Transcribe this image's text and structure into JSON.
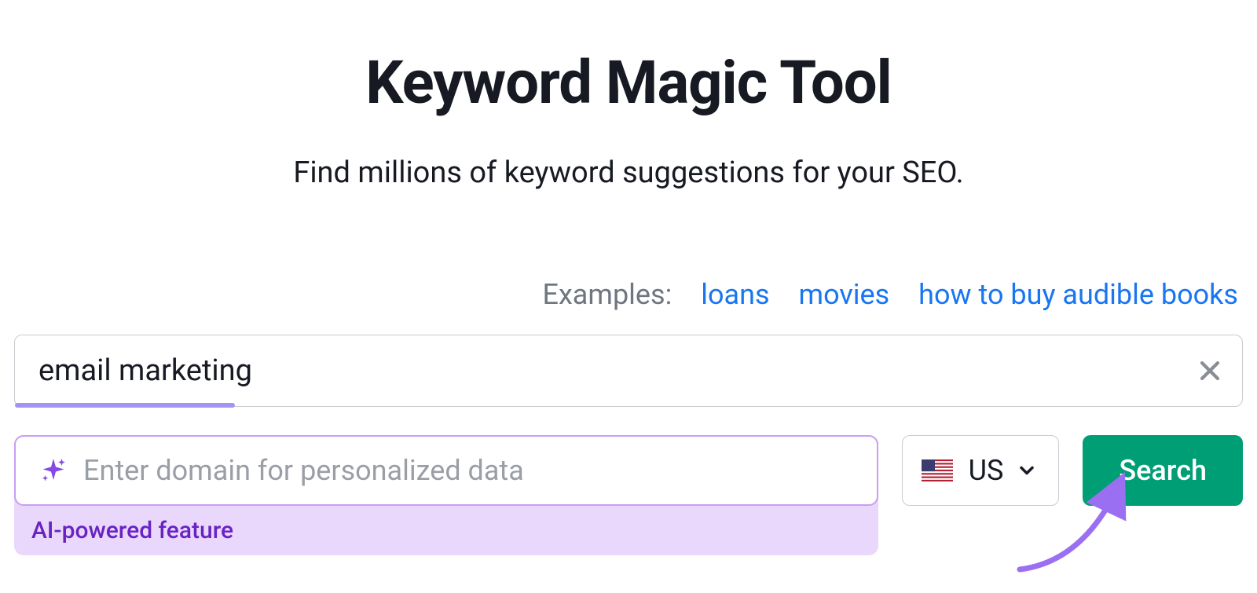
{
  "header": {
    "title": "Keyword Magic Tool",
    "subtitle": "Find millions of keyword suggestions for your SEO."
  },
  "examples": {
    "label": "Examples:",
    "items": [
      "loans",
      "movies",
      "how to buy audible books"
    ]
  },
  "keyword_input": {
    "value": "email marketing"
  },
  "domain_input": {
    "placeholder": "Enter domain for personalized data",
    "feature_label": "AI-powered feature"
  },
  "country": {
    "code": "US"
  },
  "search": {
    "label": "Search"
  }
}
